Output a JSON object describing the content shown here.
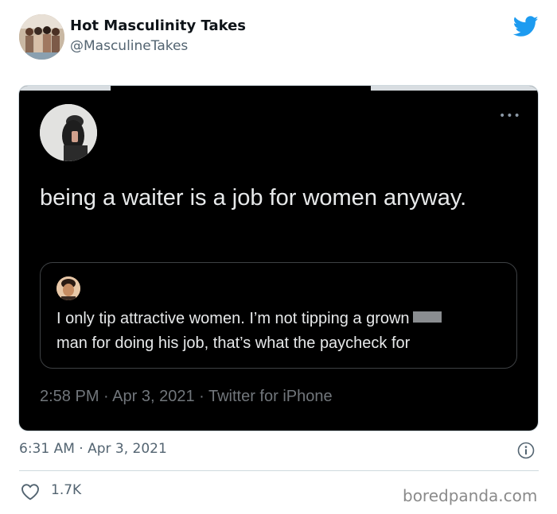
{
  "tweet": {
    "display_name": "Hot Masculinity Takes",
    "handle": "@MasculineTakes",
    "timestamp": "6:31 AM · Apr 3, 2021",
    "like_count": "1.7K",
    "icons": [
      "twitter-bird-icon",
      "info-icon",
      "heart-icon"
    ],
    "brand_color": "#1d9bf0"
  },
  "screenshot": {
    "more_label": "•••",
    "text": "being a waiter is a job for women anyway.",
    "quoted_text": "I only tip attractive women. I’m not tipping a grown",
    "quoted_text_line2": "man for doing his job, that’s what the paycheck for",
    "meta": "2:58 PM · Apr 3, 2021 · Twitter for iPhone"
  },
  "watermark": "boredpanda.com"
}
